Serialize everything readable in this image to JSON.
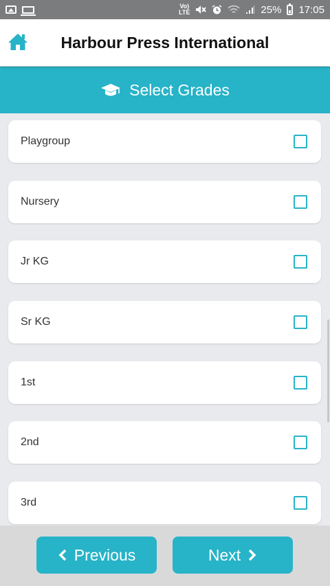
{
  "status_bar": {
    "volte_label": "Vo)\nLTE",
    "battery_percent": "25%",
    "time": "17:05"
  },
  "app": {
    "title": "Harbour Press International"
  },
  "section": {
    "title": "Select Grades"
  },
  "grades": [
    {
      "label": "Playgroup",
      "checked": false
    },
    {
      "label": "Nursery",
      "checked": false
    },
    {
      "label": "Jr KG",
      "checked": false
    },
    {
      "label": "Sr KG",
      "checked": false
    },
    {
      "label": "1st",
      "checked": false
    },
    {
      "label": "2nd",
      "checked": false
    },
    {
      "label": "3rd",
      "checked": false
    }
  ],
  "footer": {
    "previous_label": "Previous",
    "next_label": "Next"
  },
  "colors": {
    "accent": "#27b3c8",
    "status_bar": "#7b7c7e",
    "background": "#e9eaee"
  },
  "icons": {
    "home": "home-icon",
    "section": "graduation-cap-icon",
    "previous": "chevron-left-icon",
    "next": "chevron-right-icon"
  }
}
